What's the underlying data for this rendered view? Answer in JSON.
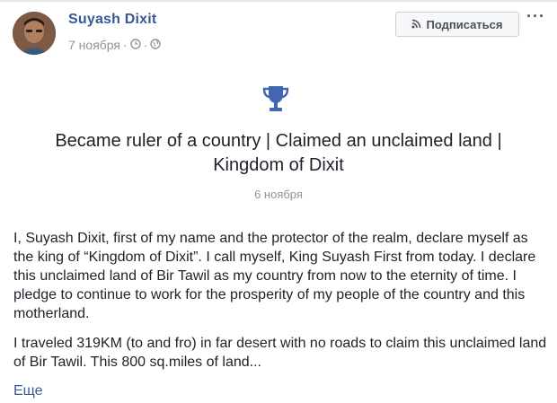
{
  "post": {
    "author": "Suyash Dixit",
    "date": "7 ноября",
    "meta_separator": "·",
    "follow_label": "Подписаться",
    "more_label": "···",
    "icons": [
      "clock-icon",
      "globe-icon",
      "rss-icon",
      "trophy-icon"
    ]
  },
  "event": {
    "title_line1": "Became ruler of a country | Claimed an unclaimed land |",
    "title_line2": "Kingdom of Dixit",
    "date": "6 ноября"
  },
  "content": {
    "paragraph1": "I, Suyash Dixit, first of my name and the protector of the realm, declare myself as the king of “Kingdom of Dixit”. I call myself, King Suyash First from today. I declare this unclaimed land of Bir Tawil as my country from now to the eternity of time. I pledge to continue to work for the prosperity of my people of the country and this motherland.",
    "paragraph2": "I traveled 319KM (to and fro) in far desert with no roads to claim this unclaimed land of Bir Tawil. This 800 sq.miles of land...",
    "see_more": "Еще"
  },
  "colors": {
    "link": "#365899",
    "muted": "#90949c",
    "trophy": "#4267b2"
  }
}
